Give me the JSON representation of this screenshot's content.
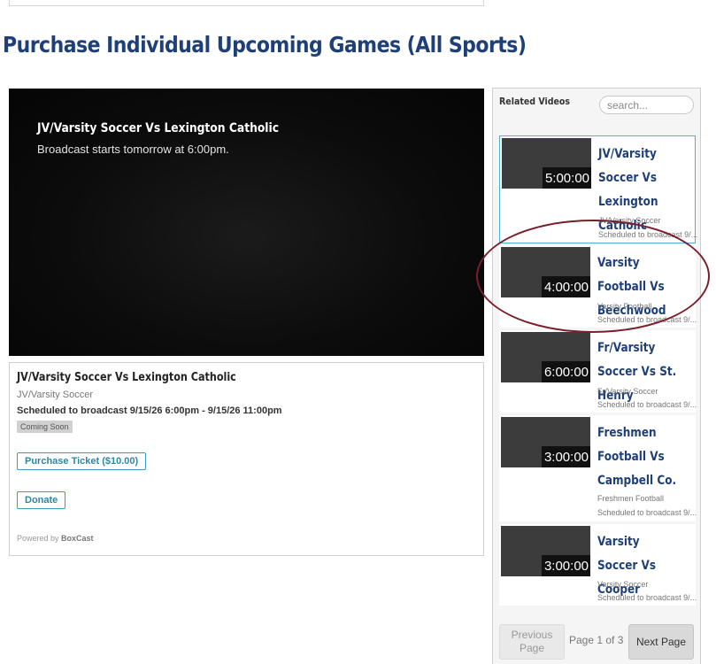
{
  "page": {
    "heading": "Purchase Individual Upcoming Games (All Sports)"
  },
  "player": {
    "title": "JV/Varsity Soccer Vs Lexington Catholic",
    "subtitle": "Broadcast starts tomorrow at 6:00pm."
  },
  "info": {
    "title": "JV/Varsity Soccer Vs Lexington Catholic",
    "category": "JV/Varsity Soccer",
    "schedule": "Scheduled to broadcast 9/15/26 6:00pm - 9/15/26 11:00pm",
    "badge": "Coming Soon",
    "purchase_label": "Purchase Ticket ($10.00)",
    "donate_label": "Donate",
    "powered_prefix": "Powered by",
    "powered_brand": "BoxCast"
  },
  "sidebar": {
    "heading": "Related Videos",
    "search_placeholder": "search...",
    "videos": [
      {
        "duration": "5:00:00",
        "title": "JV/Varsity Soccer Vs Lexington Catholic",
        "category": "JV/Varsity Soccer",
        "schedule": "Scheduled to broadcast 9/..."
      },
      {
        "duration": "4:00:00",
        "title": "Varsity Football Vs Beechwood",
        "category": "Varsity Football",
        "schedule": "Scheduled to broadcast 9/..."
      },
      {
        "duration": "6:00:00",
        "title": "Fr/Varsity Soccer Vs St. Henry",
        "category": "Fr/Varsity Soccer",
        "schedule": "Scheduled to broadcast 9/..."
      },
      {
        "duration": "3:00:00",
        "title": "Freshmen Football Vs Campbell Co.",
        "category": "Freshmen Football",
        "schedule": "Scheduled to broadcast 9/..."
      },
      {
        "duration": "3:00:00",
        "title": "Varsity Soccer Vs Cooper",
        "category": "Varsity Soccer",
        "schedule": "Scheduled to broadcast 9/..."
      }
    ],
    "pager": {
      "prev_label": "Previous Page",
      "page_label": "Page 1 of 3",
      "next_label": "Next Page"
    }
  },
  "colors": {
    "heading": "#1f3f78",
    "accent": "#3a9db7",
    "highlight_ring": "#7b1e2b"
  }
}
